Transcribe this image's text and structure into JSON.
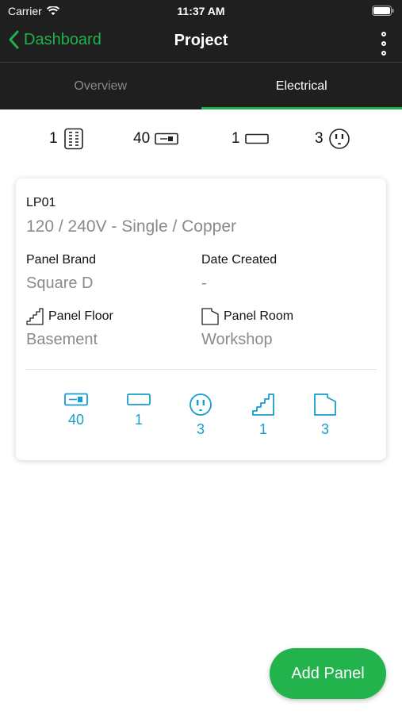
{
  "status_bar": {
    "carrier": "Carrier",
    "time": "11:37 AM"
  },
  "nav": {
    "back_label": "Dashboard",
    "title": "Project"
  },
  "tabs": [
    {
      "label": "Overview",
      "active": false
    },
    {
      "label": "Electrical",
      "active": true
    }
  ],
  "summary": [
    {
      "value": "1",
      "icon": "panel-grid-icon"
    },
    {
      "value": "40",
      "icon": "breaker-icon"
    },
    {
      "value": "1",
      "icon": "fixture-icon"
    },
    {
      "value": "3",
      "icon": "outlet-icon"
    }
  ],
  "panel_card": {
    "name": "LP01",
    "spec": "120 / 240V - Single / Copper",
    "brand_label": "Panel Brand",
    "brand_value": "Square D",
    "date_label": "Date Created",
    "date_value": "-",
    "floor_label": "Panel Floor",
    "floor_value": "Basement",
    "room_label": "Panel Room",
    "room_value": "Workshop",
    "counts": [
      {
        "value": "40",
        "icon": "breaker-icon"
      },
      {
        "value": "1",
        "icon": "fixture-icon"
      },
      {
        "value": "3",
        "icon": "outlet-icon"
      },
      {
        "value": "1",
        "icon": "stairs-icon"
      },
      {
        "value": "3",
        "icon": "room-icon"
      }
    ]
  },
  "fab": {
    "label": "Add Panel"
  },
  "colors": {
    "accent_green": "#1fb24a",
    "accent_blue": "#169fcf",
    "header_bg": "#1f1f1f"
  }
}
